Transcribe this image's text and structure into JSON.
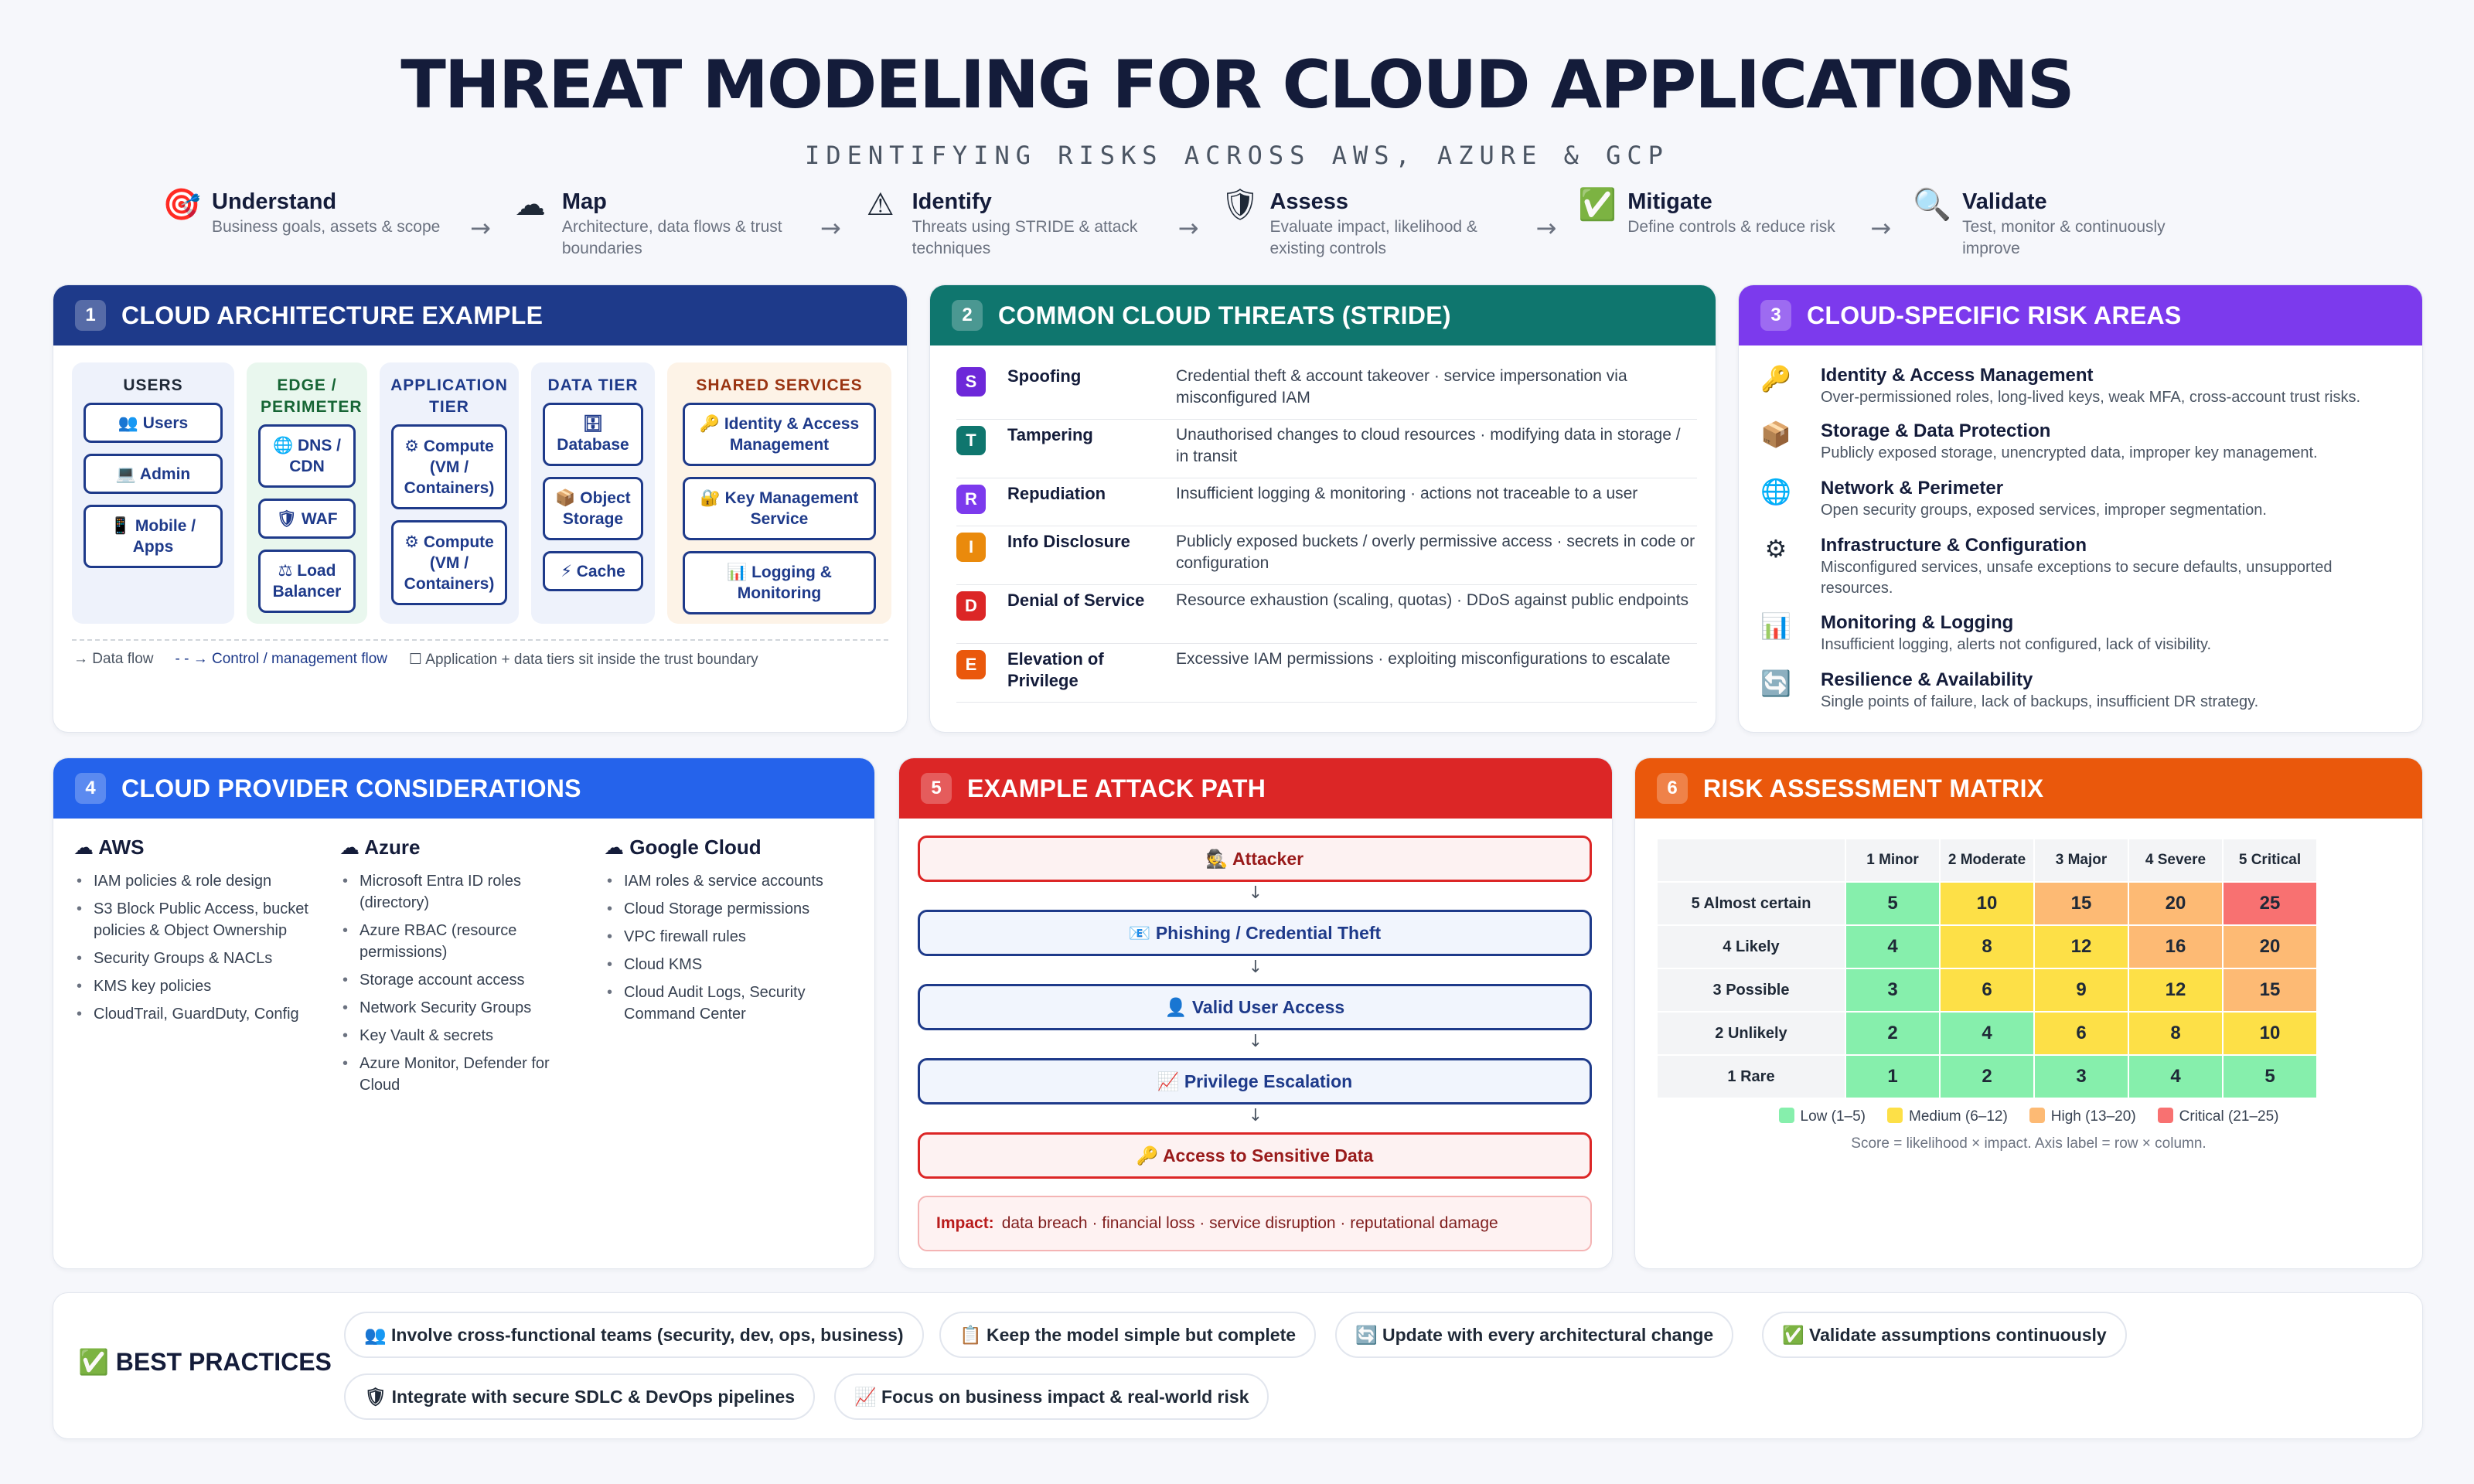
{
  "header": {
    "title": "THREAT MODELING FOR CLOUD APPLICATIONS",
    "subtitle": "IDENTIFYING RISKS ACROSS AWS, AZURE & GCP"
  },
  "steps": [
    {
      "icon": "🎯",
      "title": "Understand",
      "desc": "Business goals, assets & scope",
      "desc2": ""
    },
    {
      "icon": "☁",
      "title": "Map",
      "desc": "Architecture, data flows & trust",
      "desc2": "boundaries"
    },
    {
      "icon": "⚠",
      "title": "Identify",
      "desc": "Threats using STRIDE & attack",
      "desc2": "techniques"
    },
    {
      "icon": "🛡",
      "title": "Assess",
      "desc": "Evaluate impact, likelihood &",
      "desc2": "existing controls"
    },
    {
      "icon": "✅",
      "title": "Mitigate",
      "desc": "Define controls & reduce risk",
      "desc2": ""
    },
    {
      "icon": "🔍",
      "title": "Validate",
      "desc": "Test, monitor & continuously",
      "desc2": "improve"
    }
  ],
  "arrow": "→",
  "p1": {
    "num": "1",
    "title": "CLOUD ARCHITECTURE EXAMPLE",
    "cols": {
      "users": {
        "title": "USERS",
        "nodes": [
          "👥 Users",
          "💻 Admin",
          "📱 Mobile / Apps"
        ]
      },
      "edge": {
        "title": "EDGE / PERIMETER",
        "nodes": [
          "🌐 DNS / CDN",
          "🛡 WAF",
          "⚖ Load Balancer"
        ]
      },
      "app": {
        "title": "APPLICATION TIER",
        "nodes": [
          "⚙ Compute (VM / Containers)",
          "⚙ Compute (VM / Containers)"
        ]
      },
      "data": {
        "title": "DATA TIER",
        "nodes": [
          "🗄 Database",
          "📦 Object Storage",
          "⚡ Cache"
        ]
      },
      "shared": {
        "title": "SHARED SERVICES",
        "nodes": [
          "🔑 Identity & Access Management",
          "🔐 Key Management Service",
          "📊 Logging & Monitoring"
        ]
      }
    },
    "legend": [
      "→ Data flow",
      "- - → Control / management flow",
      "☐ Application + data tiers sit inside the trust boundary"
    ]
  },
  "p2": {
    "num": "2",
    "title": "COMMON CLOUD THREATS (STRIDE)",
    "threats": [
      {
        "letter": "S",
        "name": "Spoofing",
        "desc": "Credential theft & account takeover · service impersonation via misconfigured IAM",
        "color": "#6d28d9"
      },
      {
        "letter": "T",
        "name": "Tampering",
        "desc": "Unauthorised changes to cloud resources · modifying data in storage / in transit",
        "color": "#0f766e"
      },
      {
        "letter": "R",
        "name": "Repudiation",
        "desc": "Insufficient logging & monitoring · actions not traceable to a user",
        "color": "#7c3aed"
      },
      {
        "letter": "I",
        "name": "Info Disclosure",
        "desc": "Publicly exposed buckets / overly permissive access · secrets in code or configuration",
        "color": "#ea8a0c"
      },
      {
        "letter": "D",
        "name": "Denial of Service",
        "desc": "Resource exhaustion (scaling, quotas) · DDoS against public endpoints",
        "color": "#dc2626"
      },
      {
        "letter": "E",
        "name": "Elevation of Privilege",
        "desc": "Excessive IAM permissions · exploiting misconfigurations to escalate",
        "color": "#ea580c"
      }
    ]
  },
  "p3": {
    "num": "3",
    "title": "CLOUD-SPECIFIC RISK AREAS",
    "items": [
      {
        "icon": "🔑",
        "title": "Identity & Access Management",
        "desc": "Over-permissioned roles, long-lived keys, weak MFA, cross-account trust risks."
      },
      {
        "icon": "📦",
        "title": "Storage & Data Protection",
        "desc": "Publicly exposed storage, unencrypted data, improper key management."
      },
      {
        "icon": "🌐",
        "title": "Network & Perimeter",
        "desc": "Open security groups, exposed services, improper segmentation."
      },
      {
        "icon": "⚙",
        "title": "Infrastructure & Configuration",
        "desc": "Misconfigured services, unsafe exceptions to secure defaults, unsupported resources."
      },
      {
        "icon": "📊",
        "title": "Monitoring & Logging",
        "desc": "Insufficient logging, alerts not configured, lack of visibility."
      },
      {
        "icon": "🔄",
        "title": "Resilience & Availability",
        "desc": "Single points of failure, lack of backups, insufficient DR strategy."
      }
    ]
  },
  "p4": {
    "num": "4",
    "title": "CLOUD PROVIDER CONSIDERATIONS",
    "providers": [
      {
        "name": "☁ AWS",
        "items": [
          "IAM policies & role design",
          "S3 Block Public Access, bucket policies & Object Ownership",
          "Security Groups & NACLs",
          "KMS key policies",
          "CloudTrail, GuardDuty, Config"
        ]
      },
      {
        "name": "☁ Azure",
        "items": [
          "Microsoft Entra ID roles (directory)",
          "Azure RBAC (resource permissions)",
          "Storage account access",
          "Network Security Groups",
          "Key Vault & secrets",
          "Azure Monitor, Defender for Cloud"
        ]
      },
      {
        "name": "☁ Google Cloud",
        "items": [
          "IAM roles & service accounts",
          "Cloud Storage permissions",
          "VPC firewall rules",
          "Cloud KMS",
          "Cloud Audit Logs, Security Command Center"
        ]
      }
    ]
  },
  "p5": {
    "num": "5",
    "title": "EXAMPLE ATTACK PATH",
    "steps": [
      "🕵 Attacker",
      "📧 Phishing / Credential Theft",
      "👤 Valid User Access",
      "📈 Privilege Escalation",
      "🔑 Access to Sensitive Data"
    ],
    "down": "↓",
    "impact_label": "Impact:",
    "impact_text": "data breach · financial loss · service disruption · reputational damage"
  },
  "p6": {
    "num": "6",
    "title": "RISK ASSESSMENT MATRIX",
    "columns": [
      "1 Minor",
      "2 Moderate",
      "3 Major",
      "4 Severe",
      "5 Critical"
    ],
    "rows": [
      {
        "label": "5 Almost certain",
        "values": [
          "5",
          "10",
          "15",
          "20",
          "25"
        ],
        "levels": [
          "lo",
          "me",
          "hi",
          "hi",
          "cr"
        ]
      },
      {
        "label": "4 Likely",
        "values": [
          "4",
          "8",
          "12",
          "16",
          "20"
        ],
        "levels": [
          "lo",
          "me",
          "me",
          "hi",
          "hi"
        ]
      },
      {
        "label": "3 Possible",
        "values": [
          "3",
          "6",
          "9",
          "12",
          "15"
        ],
        "levels": [
          "lo",
          "me",
          "me",
          "me",
          "hi"
        ]
      },
      {
        "label": "2 Unlikely",
        "values": [
          "2",
          "4",
          "6",
          "8",
          "10"
        ],
        "levels": [
          "lo",
          "lo",
          "me",
          "me",
          "me"
        ]
      },
      {
        "label": "1 Rare",
        "values": [
          "1",
          "2",
          "3",
          "4",
          "5"
        ],
        "levels": [
          "lo",
          "lo",
          "lo",
          "lo",
          "lo"
        ]
      }
    ],
    "legend": [
      {
        "label": "Low (1–5)",
        "color": "#86efac"
      },
      {
        "label": "Medium (6–12)",
        "color": "#fde047"
      },
      {
        "label": "High (13–20)",
        "color": "#fdba74"
      },
      {
        "label": "Critical (21–25)",
        "color": "#f87171"
      }
    ],
    "note": "Score = likelihood × impact. Axis label = row × column."
  },
  "best": {
    "label": "✅ BEST PRACTICES",
    "items": [
      "👥 Involve cross-functional teams (security, dev, ops, business)",
      "📋 Keep the model simple but complete",
      "🔄 Update with every architectural change",
      "✅ Validate assumptions continuously",
      "🛡 Integrate with secure SDLC & DevOps pipelines",
      "📈 Focus on business impact & real-world risk"
    ]
  },
  "colors": {
    "p1": "#1e3a8a",
    "p2": "#0f766e",
    "p3": "#7c3aed",
    "p4": "#2563eb",
    "p5": "#dc2626",
    "p6": "#ea580c"
  }
}
